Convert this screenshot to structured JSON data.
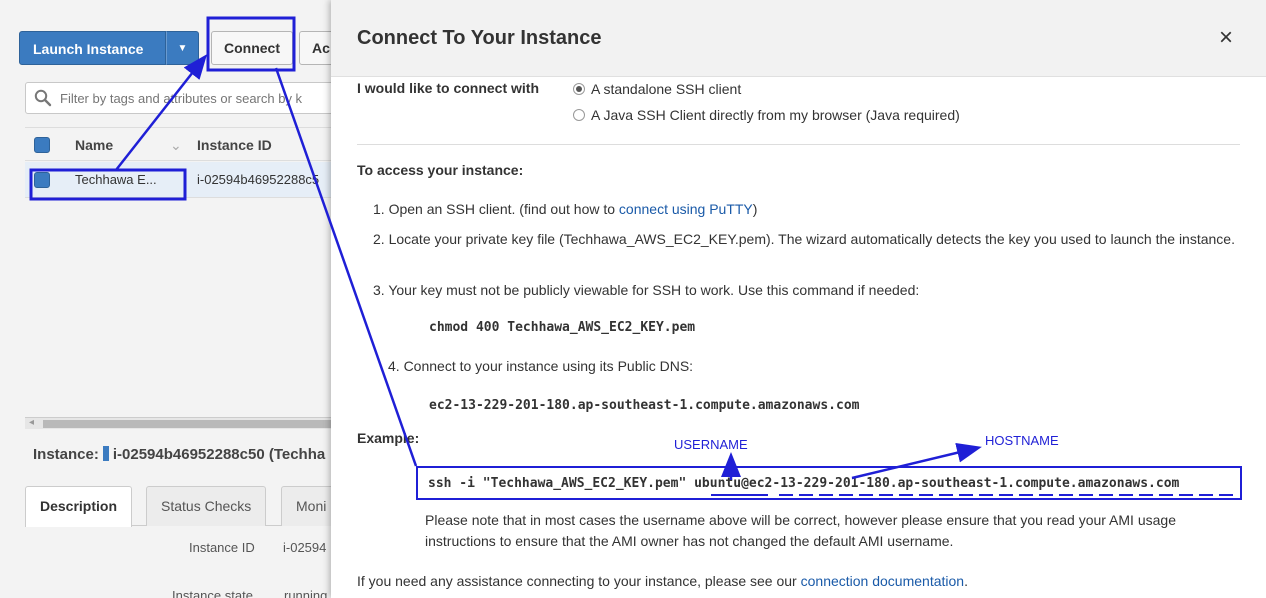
{
  "console": {
    "launch_label": "Launch Instance",
    "connect_label": "Connect",
    "actions_label": "Ac",
    "filter_placeholder": "Filter by tags and attributes or search by k",
    "columns": {
      "name": "Name",
      "instance_id": "Instance ID"
    },
    "row": {
      "name": "Techhawa E...",
      "instance_id": "i-02594b46952288c5"
    },
    "instance_prefix": "Instance:",
    "instance_text": "i-02594b46952288c50 (Techha",
    "tabs": [
      "Description",
      "Status Checks",
      "Moni"
    ],
    "desc": {
      "instance_id_label": "Instance ID",
      "instance_id_value": "i-02594",
      "instance_state_label": "Instance state",
      "instance_state_value": "running"
    }
  },
  "modal": {
    "title": "Connect To Your Instance",
    "close_glyph": "×",
    "connect_with_label": "I would like to connect with",
    "options": [
      {
        "label": "A standalone SSH client",
        "checked": true
      },
      {
        "label": "A Java SSH Client directly from my browser (Java required)",
        "checked": false
      }
    ],
    "access_heading": "To access your instance:",
    "step1_prefix": "1. Open an SSH client. (find out how to ",
    "step1_link": "connect using PuTTY",
    "step1_suffix": ")",
    "step2": "2. Locate your private key file (Techhawa_AWS_EC2_KEY.pem). The wizard automatically detects the key you used to launch the instance.",
    "step3": "3. Your key must not be publicly viewable for SSH to work. Use this command if needed:",
    "chmod_cmd": "chmod 400 Techhawa_AWS_EC2_KEY.pem",
    "step4": "4. Connect to your instance using its Public DNS:",
    "public_dns": "ec2-13-229-201-180.ap-southeast-1.compute.amazonaws.com",
    "example_label": "Example:",
    "ssh_cmd": "ssh -i \"Techhawa_AWS_EC2_KEY.pem\" ubuntu@ec2-13-229-201-180.ap-southeast-1.compute.amazonaws.com",
    "note": "Please note that in most cases the username above will be correct, however please ensure that you read your AMI usage instructions to ensure that the AMI owner has not changed the default AMI username.",
    "footer_prefix": "If you need any assistance connecting to your instance, please see our ",
    "footer_link": "connection documentation",
    "footer_suffix": "."
  },
  "annotations": {
    "username": "USERNAME",
    "hostname": "HOSTNAME",
    "color": "#1f1fd6"
  },
  "colors": {
    "primary_button": "#3b7bc0",
    "link": "#1a5aa8"
  }
}
